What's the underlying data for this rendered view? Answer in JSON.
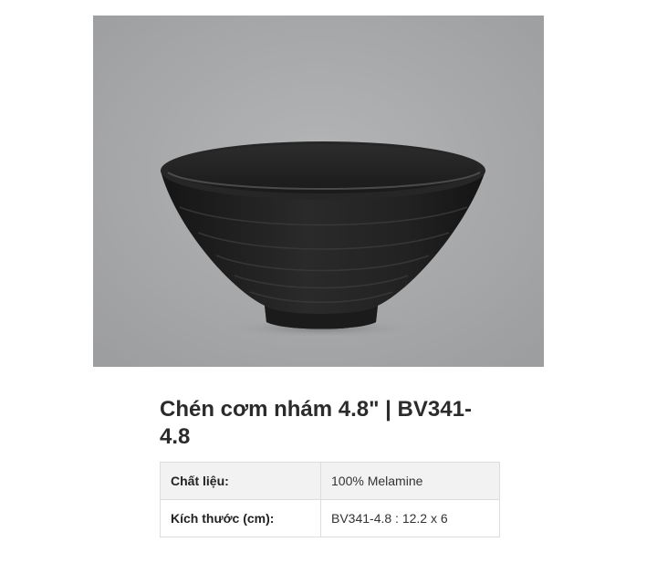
{
  "product": {
    "image_subject": "black-melamine-bowl",
    "title": "Chén cơm nhám 4.8\" | BV341-4.8",
    "specs": [
      {
        "label": "Chất liệu:",
        "value": "100% Melamine"
      },
      {
        "label": "Kích thước (cm):",
        "value": "BV341-4.8 : 12.2 x 6"
      }
    ]
  },
  "colors": {
    "image_background": "#a7a8aa",
    "bowl": "#1e1e1e",
    "table_header_row": "#f2f2f2",
    "table_border": "#dddddd"
  }
}
